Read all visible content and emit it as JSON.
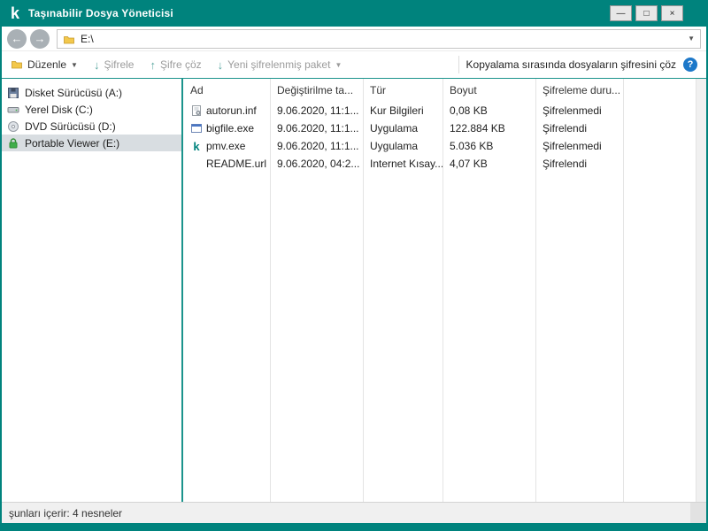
{
  "titlebar": {
    "title": "Taşınabilir Dosya Yöneticisi",
    "logo_glyph": "k",
    "minimize_glyph": "—",
    "maximize_glyph": "□",
    "close_glyph": "×"
  },
  "navbar": {
    "back_glyph": "←",
    "forward_glyph": "→",
    "address_path": "E:\\",
    "address_caret_glyph": "▼"
  },
  "toolbar": {
    "edit_label": "Düzenle",
    "encrypt_label": "Şifrele",
    "decrypt_label": "Şifre çöz",
    "new_package_label": "Yeni şifrelenmiş paket",
    "decrypt_on_copy_label": "Kopyalama sırasında dosyaların şifresini çöz",
    "caret_glyph": "▼",
    "down_arrow_glyph": "↓",
    "up_arrow_glyph": "↑",
    "help_glyph": "?"
  },
  "sidebar": {
    "items": [
      {
        "label": "Disket Sürücüsü (A:)",
        "icon": "floppy-drive-icon",
        "selected": false
      },
      {
        "label": "Yerel Disk (C:)",
        "icon": "hard-disk-icon",
        "selected": false
      },
      {
        "label": "DVD Sürücüsü (D:)",
        "icon": "dvd-drive-icon",
        "selected": false
      },
      {
        "label": "Portable Viewer (E:)",
        "icon": "lock-icon",
        "selected": true
      }
    ]
  },
  "filelist": {
    "columns": [
      "Ad",
      "Değiştirilme ta...",
      "Tür",
      "Boyut",
      "Şifreleme duru..."
    ],
    "kaspersky_glyph": "k",
    "rows": [
      {
        "name": "autorun.inf",
        "modified": "9.06.2020, 11:1...",
        "type": "Kur Bilgileri",
        "size": "0,08 KB",
        "encryption": "Şifrelenmedi",
        "icon": "inf-file-icon"
      },
      {
        "name": "bigfile.exe",
        "modified": "9.06.2020, 11:1...",
        "type": "Uygulama",
        "size": "122.884 KB",
        "encryption": "Şifrelendi",
        "icon": "exe-file-icon"
      },
      {
        "name": "pmv.exe",
        "modified": "9.06.2020, 11:1...",
        "type": "Uygulama",
        "size": "5.036 KB",
        "encryption": "Şifrelenmedi",
        "icon": "kaspersky-app-icon"
      },
      {
        "name": "README.url",
        "modified": "9.06.2020, 04:2...",
        "type": "Internet Kısay...",
        "size": "4,07 KB",
        "encryption": "Şifrelendi",
        "icon": "url-file-icon"
      }
    ]
  },
  "statusbar": {
    "text": "şunları içerir: 4 nesneler"
  },
  "colors": {
    "brand_teal": "#00837D",
    "separator_teal": "#1B948C",
    "help_blue": "#1D78C9",
    "selection_gray": "#D8DDE1",
    "lock_green": "#3FAE49"
  }
}
